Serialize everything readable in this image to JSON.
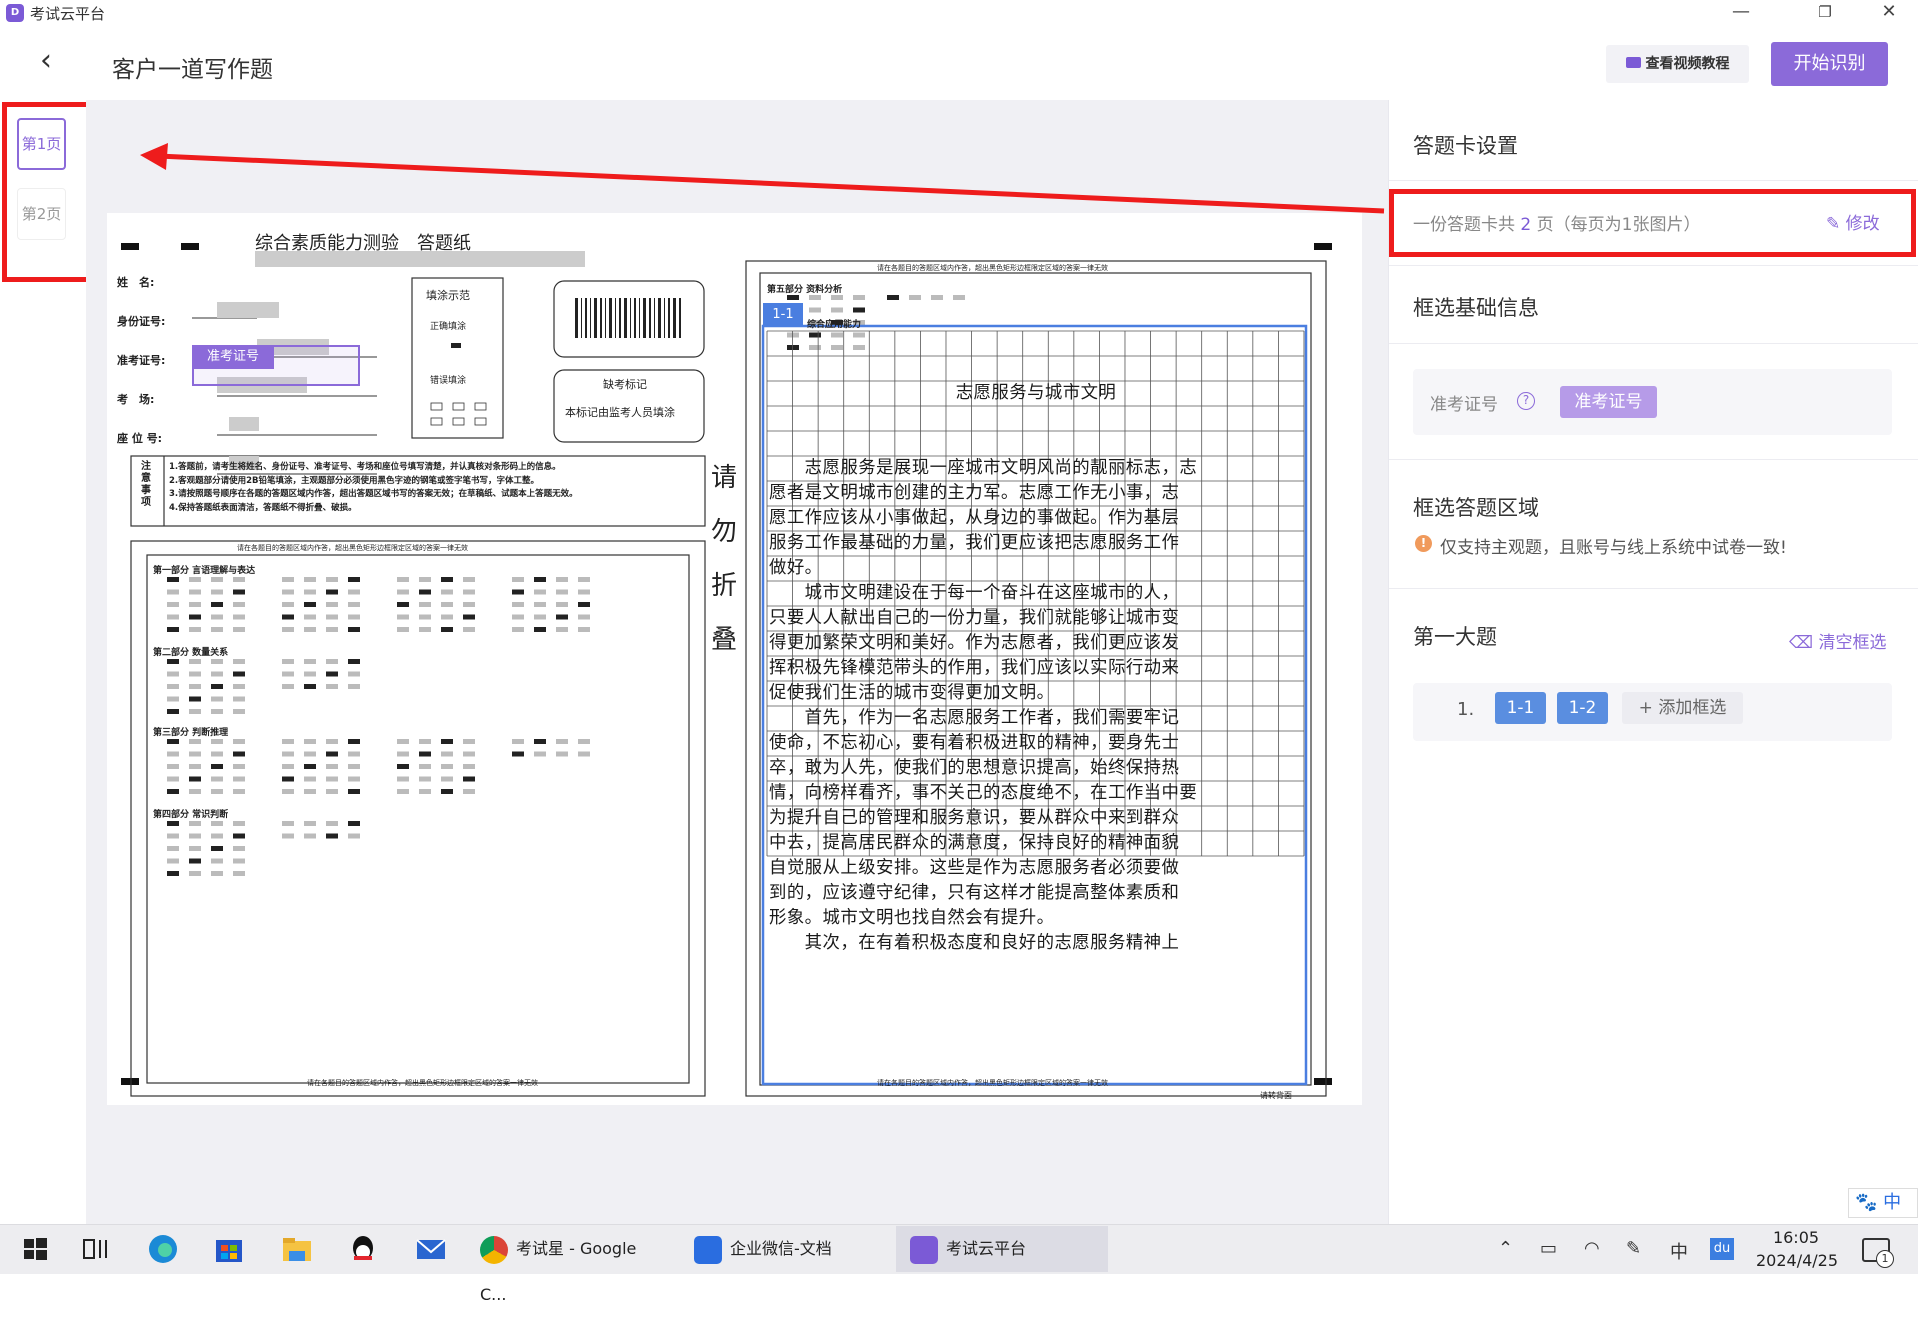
{
  "window": {
    "app_title": "考试云平台",
    "logo_letter": "D",
    "min": "—",
    "restore": "❐",
    "close": "✕"
  },
  "header": {
    "back_icon": "‹",
    "title": "客户一道写作题",
    "video_button": "查看视频教程",
    "start_button": "开始识别"
  },
  "thumbnails": [
    {
      "label": "第1页",
      "selected": true
    },
    {
      "label": "第2页",
      "selected": false
    }
  ],
  "sheet": {
    "title": "综合素质能力测验　答题纸",
    "fields": [
      "姓　名:",
      "身份证号:",
      "准考证号:",
      "考　场:",
      "座 位 号:"
    ],
    "exam_no_tag": "准考证号",
    "fill_demo_title": "填涂示范",
    "fill_correct": "正确填涂",
    "fill_wrong": "错误填涂",
    "absent_title": "缺考标记",
    "absent_note": "本标记由监考人员填涂",
    "notice_title": "注意事项",
    "notices": [
      "1.答题前，请考生将姓名、身份证号、准考证号、考场和座位号填写清楚，并认真核对条形码上的信息。",
      "2.客观题部分请使用2B铅笔填涂，主观题部分必须使用黑色字迹的钢笔或签字笔书写，字体工整。",
      "3.请按照题号顺序在各题的答题区域内作答，超出答题区域书写的答案无效；在草稿纸、试题本上答题无效。",
      "4.保持答题纸表面清洁，答题纸不得折叠、破损。"
    ],
    "area_note": "请在各题目的答题区域内作答，超出黑色矩形边框限定区域的答案一律无效",
    "parts": [
      "第一部分 言语理解与表达",
      "第二部分 数量关系",
      "第三部分 判断推理",
      "第四部分 常识判断"
    ],
    "fold_text": [
      "请",
      "勿",
      "折",
      "叠"
    ],
    "part5": "第五部分 资料分析",
    "part6": "综合应用能力",
    "box_tag": "1-1",
    "essay_title": "志愿服务与城市文明",
    "essay_lines": [
      "　　志愿服务是展现一座城市文明风尚的靓丽标志，志",
      "愿者是文明城市创建的主力军。志愿工作无小事，志",
      "愿工作应该从小事做起，从身边的事做起。作为基层",
      "服务工作最基础的力量，我们更应该把志愿服务工作",
      "做好。",
      "　　城市文明建设在于每一个奋斗在这座城市的人，",
      "只要人人献出自己的一份力量，我们就能够让城市变",
      "得更加繁荣文明和美好。作为志愿者，我们更应该发",
      "挥积极先锋模范带头的作用，我们应该以实际行动来",
      "促使我们生活的城市变得更加文明。",
      "　　首先，作为一名志愿服务工作者，我们需要牢记",
      "使命，不忘初心，要有着积极进取的精神，要身先士",
      "卒，敢为人先，使我们的思想意识提高，始终保持热",
      "情，向榜样看齐，事不关己的态度绝不，在工作当中要",
      "为提升自己的管理和服务意识，要从群众中来到群众",
      "中去，提高居民群众的满意度，保持良好的精神面貌",
      "自觉服从上级安排。这些是作为志愿服务者必须要做",
      "到的，应该遵守纪律，只有这样才能提高整体素质和",
      "形象。城市文明也找自然会有提升。",
      "　　其次，在有着积极态度和良好的志愿服务精神上"
    ],
    "footer_note": "请在各题目的答题区域内作答，超出黑色矩形边框限定区域的答案一律无效",
    "turn_note": "请转背面"
  },
  "panel": {
    "card_settings_title": "答题卡设置",
    "card_info_prefix": "一份答题卡共 ",
    "card_pages": "2",
    "card_info_suffix": " 页（每页为1张图片）",
    "modify": "修改",
    "basic_title": "框选基础信息",
    "exam_no_label": "准考证号",
    "exam_no_chip": "准考证号",
    "answer_area_title": "框选答题区域",
    "warning": "仅支持主观题，且账号与线上系统中试卷一致!",
    "section_title": "第一大题",
    "clear": "清空框选",
    "question_number": "1.",
    "boxes": [
      "1-1",
      "1-2"
    ],
    "add_box": "+ 添加框选"
  },
  "ime": {
    "label": "中"
  },
  "taskbar": {
    "apps": [
      "考试星 - Google C...",
      "企业微信-文档",
      "考试云平台"
    ],
    "time": "16:05",
    "date": "2024/4/25",
    "tray_ime": "中",
    "tray_du": "du",
    "notification_count": "1"
  },
  "colors": {
    "accent": "#8b6ad9",
    "blue": "#5a8ee0",
    "annotation_red": "#ee1c1c"
  }
}
